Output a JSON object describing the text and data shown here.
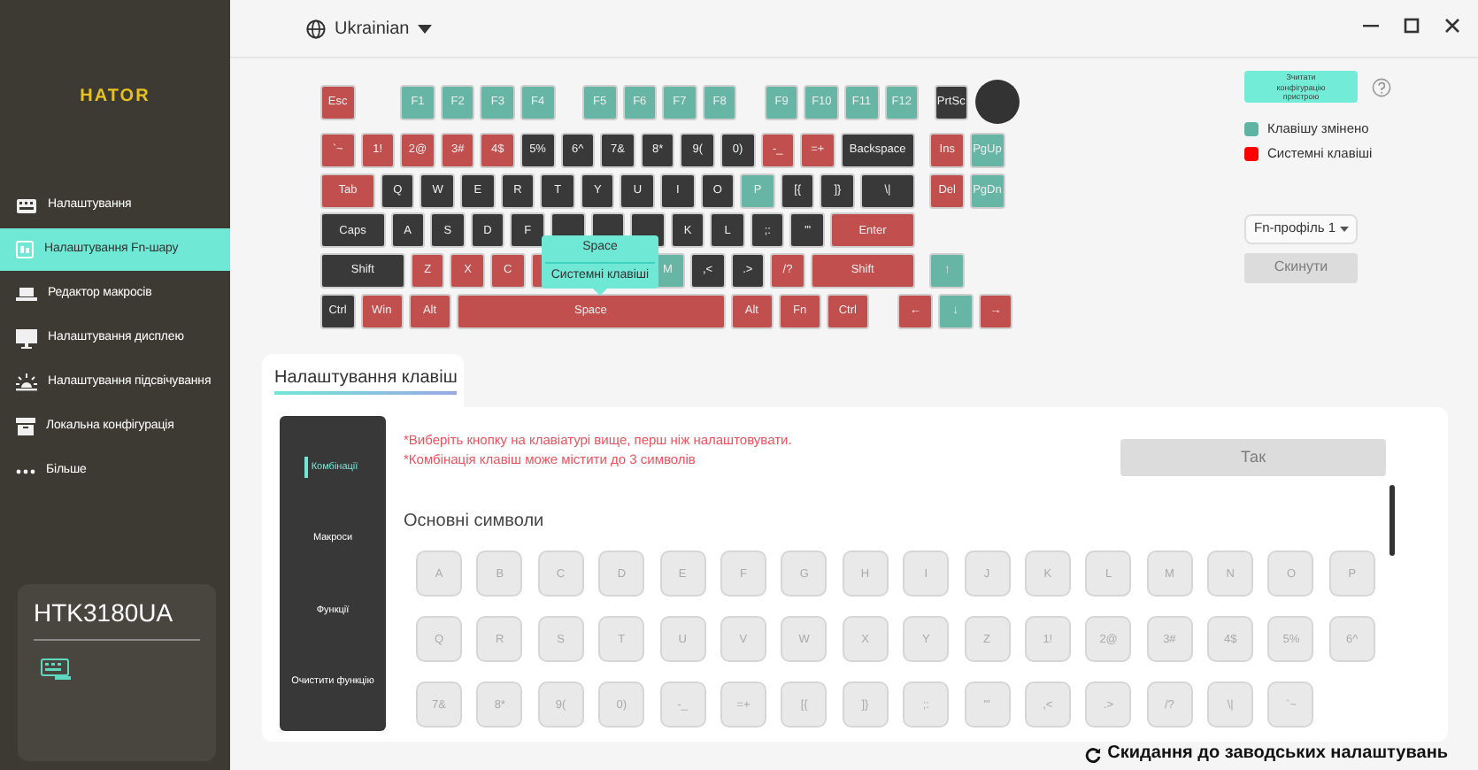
{
  "sidebar": {
    "logo": "HATOR",
    "items": [
      {
        "label": "Налаштування",
        "selected": false
      },
      {
        "label": "Налаштування Fn-шару",
        "selected": true
      },
      {
        "label": "Редактор макросів",
        "selected": false
      },
      {
        "label": "Налаштування дисплею",
        "selected": false
      },
      {
        "label": "Налаштування підсвічування",
        "selected": false
      },
      {
        "label": "Локальна конфігурація",
        "selected": false
      },
      {
        "label": "Більше",
        "selected": false
      }
    ],
    "device": {
      "name": "HTK3180UA"
    }
  },
  "topbar": {
    "language": "Ukrainian"
  },
  "keyboard": {
    "rows": [
      {
        "keys": [
          {
            "label": "Esc",
            "kind": "system"
          },
          {
            "label": "F1",
            "kind": "changed"
          },
          {
            "label": "F2",
            "kind": "changed"
          },
          {
            "label": "F3",
            "kind": "changed"
          },
          {
            "label": "F4",
            "kind": "changed"
          },
          {
            "label": "F5",
            "kind": "changed"
          },
          {
            "label": "F6",
            "kind": "changed"
          },
          {
            "label": "F7",
            "kind": "changed"
          },
          {
            "label": "F8",
            "kind": "changed"
          },
          {
            "label": "F9",
            "kind": "changed"
          },
          {
            "label": "F10",
            "kind": "changed"
          },
          {
            "label": "F11",
            "kind": "changed"
          },
          {
            "label": "F12",
            "kind": "changed"
          },
          {
            "label": "PrtSc",
            "kind": "normal"
          },
          {
            "kind": "knob"
          }
        ]
      },
      {
        "keys": [
          {
            "label": "`~",
            "kind": "system"
          },
          {
            "label": "1!",
            "kind": "system"
          },
          {
            "label": "2@",
            "kind": "system"
          },
          {
            "label": "3#",
            "kind": "system"
          },
          {
            "label": "4$",
            "kind": "system"
          },
          {
            "label": "5%",
            "kind": "normal"
          },
          {
            "label": "6^",
            "kind": "normal"
          },
          {
            "label": "7&",
            "kind": "normal"
          },
          {
            "label": "8*",
            "kind": "normal"
          },
          {
            "label": "9(",
            "kind": "normal"
          },
          {
            "label": "0)",
            "kind": "normal"
          },
          {
            "label": "-_",
            "kind": "system"
          },
          {
            "label": "=+",
            "kind": "system"
          },
          {
            "label": "Backspace",
            "kind": "normal"
          },
          {
            "label": "Ins",
            "kind": "system"
          },
          {
            "label": "PgUp",
            "kind": "changed"
          }
        ]
      },
      {
        "keys": [
          {
            "label": "Tab",
            "kind": "system"
          },
          {
            "label": "Q",
            "kind": "normal"
          },
          {
            "label": "W",
            "kind": "normal"
          },
          {
            "label": "E",
            "kind": "normal"
          },
          {
            "label": "R",
            "kind": "normal"
          },
          {
            "label": "T",
            "kind": "normal"
          },
          {
            "label": "Y",
            "kind": "normal"
          },
          {
            "label": "U",
            "kind": "normal"
          },
          {
            "label": "I",
            "kind": "normal"
          },
          {
            "label": "O",
            "kind": "normal"
          },
          {
            "label": "P",
            "kind": "changed"
          },
          {
            "label": "[{",
            "kind": "normal"
          },
          {
            "label": "]}",
            "kind": "normal"
          },
          {
            "label": "\\|",
            "kind": "normal"
          },
          {
            "label": "Del",
            "kind": "system"
          },
          {
            "label": "PgDn",
            "kind": "changed"
          }
        ]
      },
      {
        "keys": [
          {
            "label": "Caps",
            "kind": "normal"
          },
          {
            "label": "A",
            "kind": "normal"
          },
          {
            "label": "S",
            "kind": "normal"
          },
          {
            "label": "D",
            "kind": "normal"
          },
          {
            "label": "F",
            "kind": "normal"
          },
          {
            "kind": "normal"
          },
          {
            "kind": "normal"
          },
          {
            "kind": "normal"
          },
          {
            "label": "K",
            "kind": "normal"
          },
          {
            "label": "L",
            "kind": "normal"
          },
          {
            "label": ";:",
            "kind": "normal"
          },
          {
            "label": "'\"",
            "kind": "normal"
          },
          {
            "label": "Enter",
            "kind": "system"
          }
        ]
      },
      {
        "keys": [
          {
            "label": "Shift",
            "kind": "normal"
          },
          {
            "label": "Z",
            "kind": "system"
          },
          {
            "label": "X",
            "kind": "system"
          },
          {
            "label": "C",
            "kind": "system"
          },
          {
            "kind": "system"
          },
          {
            "label": "M",
            "kind": "changed"
          },
          {
            "label": ",<",
            "kind": "normal"
          },
          {
            "label": ".>",
            "kind": "normal"
          },
          {
            "label": "/?",
            "kind": "system"
          },
          {
            "label": "Shift",
            "kind": "system"
          },
          {
            "label": "↑",
            "kind": "changed"
          }
        ]
      },
      {
        "keys": [
          {
            "label": "Ctrl",
            "kind": "normal"
          },
          {
            "label": "Win",
            "kind": "system"
          },
          {
            "label": "Alt",
            "kind": "system"
          },
          {
            "label": "Space",
            "kind": "system"
          },
          {
            "label": "Alt",
            "kind": "system"
          },
          {
            "label": "Fn",
            "kind": "system"
          },
          {
            "label": "Ctrl",
            "kind": "system"
          },
          {
            "label": "←",
            "kind": "system"
          },
          {
            "label": "↓",
            "kind": "changed"
          },
          {
            "label": "→",
            "kind": "system"
          }
        ]
      }
    ],
    "tooltip": {
      "title": "Space",
      "text": "Системні клавіші"
    }
  },
  "side_panel": {
    "read_button": "Зчитати конфігурацію пристрою",
    "legend": [
      {
        "label": "Клавішу змінено",
        "color": "#5fb3a3"
      },
      {
        "label": "Системні клавіші",
        "color": "#ff0000"
      }
    ],
    "profile": "Fn-профіль 1",
    "reset_button": {
      "label": "Скинути",
      "disabled": true
    }
  },
  "key_settings": {
    "tab": "Налаштування клавіш",
    "menu": [
      {
        "label": "Комбінації",
        "selected": true
      },
      {
        "label": "Макроси",
        "selected": false
      },
      {
        "label": "Функції",
        "selected": false
      },
      {
        "label": "Очистити функцію",
        "selected": false
      }
    ],
    "hints": [
      "*Виберіть кнопку на клавіатурі вище, перш ніж налаштовувати.",
      "*Комбінація клавіш може містити до 3 символів"
    ],
    "confirm_button": {
      "label": "Так",
      "disabled": true
    },
    "section_title": "Основні символи",
    "symbols": [
      [
        "A",
        "B",
        "C",
        "D",
        "E",
        "F",
        "G",
        "H",
        "I",
        "J",
        "K",
        "L",
        "M",
        "N",
        "O",
        "P"
      ],
      [
        "Q",
        "R",
        "S",
        "T",
        "U",
        "V",
        "W",
        "X",
        "Y",
        "Z",
        "1!",
        "2@",
        "3#",
        "4$",
        "5%",
        "6^"
      ],
      [
        "7&",
        "8*",
        "9(",
        "0)",
        "-_",
        "=+",
        "[{",
        "]}",
        ";:",
        "'\"",
        ",<",
        ".>",
        "/?",
        "\\|",
        "`~"
      ]
    ]
  },
  "factory_reset": "Скидання до заводських налаштувань"
}
